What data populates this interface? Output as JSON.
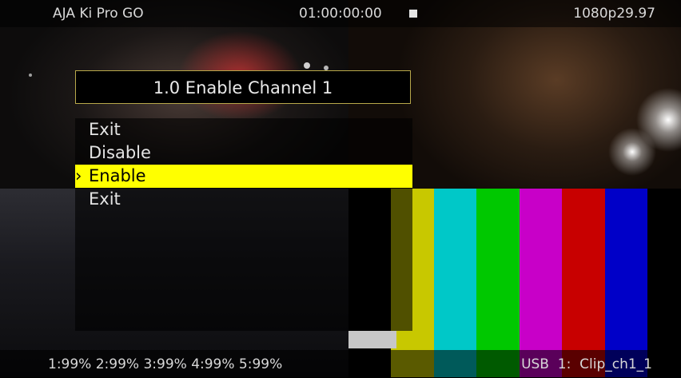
{
  "header": {
    "device_name": "AJA Ki Pro GO",
    "timecode": "01:00:00:00",
    "transport_icon": "stop-icon",
    "video_format": "1080p29.97"
  },
  "menu": {
    "title": "1.0 Enable Channel 1",
    "selector_glyph": "›",
    "items": [
      {
        "label": "Exit"
      },
      {
        "label": "Disable"
      },
      {
        "label": "Enable",
        "selected": true
      },
      {
        "label": "Exit"
      }
    ]
  },
  "footer": {
    "media_levels": "1:99% 2:99% 3:99% 4:99% 5:99%",
    "clip": "USB  1:  Clip_ch1_1"
  },
  "colors": {
    "highlight": "#ffff00",
    "title_border": "#b8a84a",
    "color_bars": [
      "#000000",
      "#c8c800",
      "#00c8c8",
      "#00c800",
      "#c800c8",
      "#c80000",
      "#0000c8",
      "#000000"
    ]
  }
}
